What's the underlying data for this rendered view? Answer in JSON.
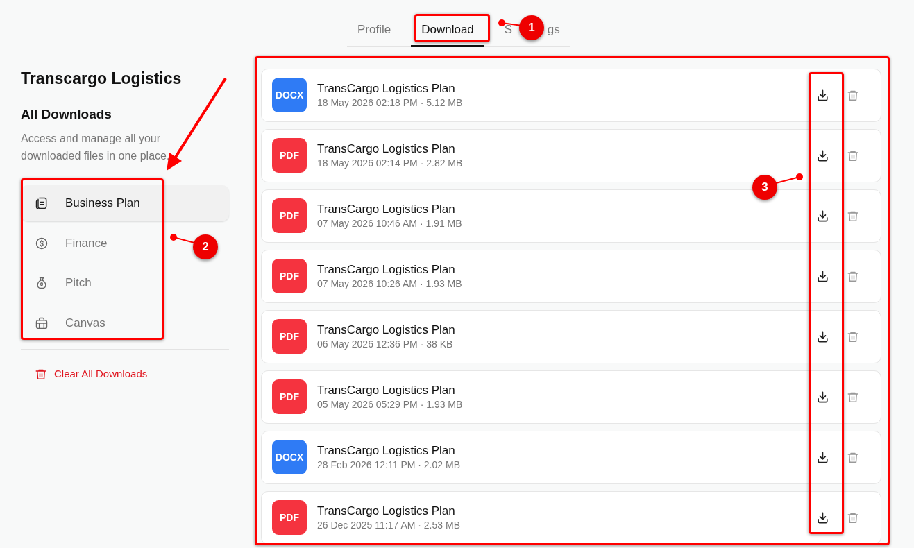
{
  "tabs": [
    {
      "label": "Profile",
      "selected": false
    },
    {
      "label": "Download",
      "selected": true
    },
    {
      "label": "S gs",
      "selected": false
    }
  ],
  "sidebar": {
    "title": "Transcargo Logistics",
    "heading": "All Downloads",
    "description": "Access and manage all your downloaded files in one place.",
    "items": [
      {
        "label": "Business Plan",
        "selected": true
      },
      {
        "label": "Finance",
        "selected": false
      },
      {
        "label": "Pitch",
        "selected": false
      },
      {
        "label": "Canvas",
        "selected": false
      }
    ],
    "clear_button": "Clear All Downloads"
  },
  "files": [
    {
      "type": "DOCX",
      "color": "#2f7bf5",
      "name": "TransCargo Logistics Plan",
      "meta": "18 May 2026 02:18 PM · 5.12 MB"
    },
    {
      "type": "PDF",
      "color": "#f5333f",
      "name": "TransCargo Logistics Plan",
      "meta": "18 May 2026 02:14 PM · 2.82 MB"
    },
    {
      "type": "PDF",
      "color": "#f5333f",
      "name": "TransCargo Logistics Plan",
      "meta": "07 May 2026 10:46 AM · 1.91 MB"
    },
    {
      "type": "PDF",
      "color": "#f5333f",
      "name": "TransCargo Logistics Plan",
      "meta": "07 May 2026 10:26 AM · 1.93 MB"
    },
    {
      "type": "PDF",
      "color": "#f5333f",
      "name": "TransCargo Logistics Plan",
      "meta": "06 May 2026 12:36 PM · 38 KB"
    },
    {
      "type": "PDF",
      "color": "#f5333f",
      "name": "TransCargo Logistics Plan",
      "meta": "05 May 2026 05:29 PM · 1.93 MB"
    },
    {
      "type": "DOCX",
      "color": "#2f7bf5",
      "name": "TransCargo Logistics Plan",
      "meta": "28 Feb 2026 12:11 PM · 2.02 MB"
    },
    {
      "type": "PDF",
      "color": "#f5333f",
      "name": "TransCargo Logistics Plan",
      "meta": "26 Dec 2025 11:17 AM · 2.53 MB"
    }
  ],
  "annotations": [
    {
      "label": "1"
    },
    {
      "label": "2"
    },
    {
      "label": "3"
    }
  ]
}
